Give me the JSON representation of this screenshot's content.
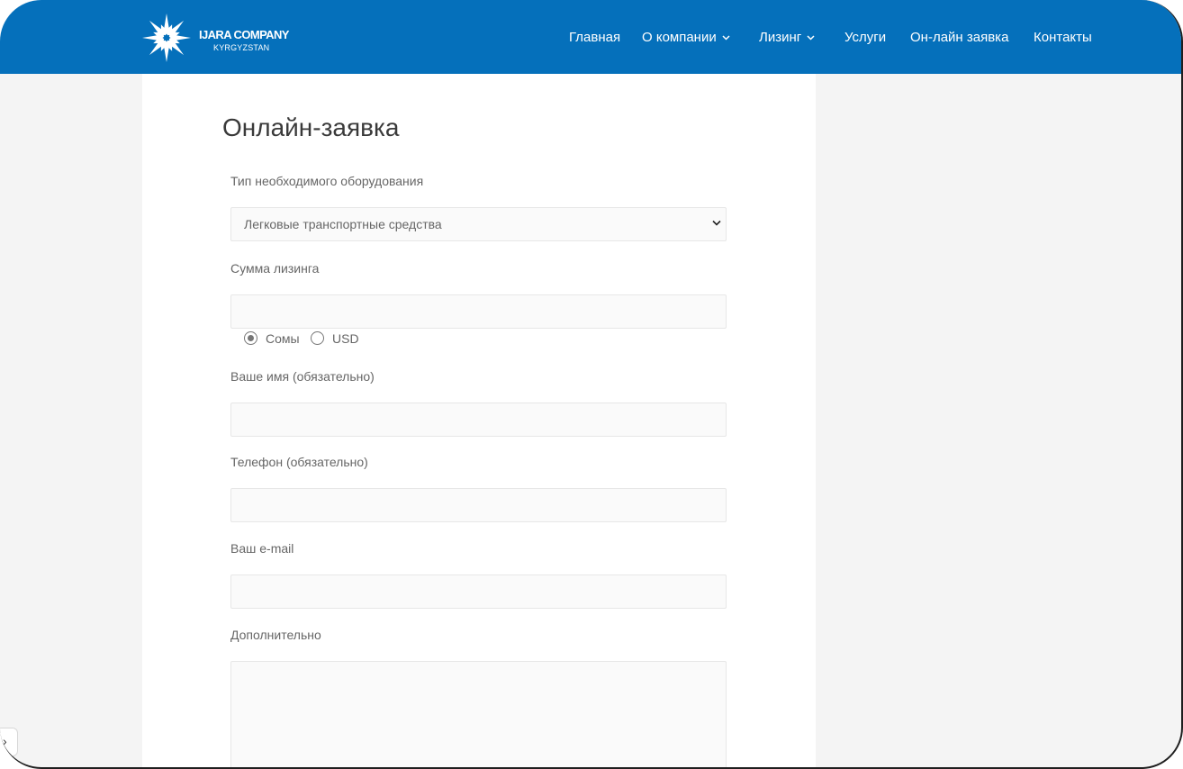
{
  "colors": {
    "header": "#0570bb",
    "page_bg": "#f4f4f4",
    "field_bg": "#fafafa"
  },
  "logo": {
    "name": "IJARA COMPANY",
    "subtitle": "KYRGYZSTAN",
    "icon": "flower-star-icon"
  },
  "nav": {
    "items": [
      {
        "label": "Главная",
        "dropdown": false
      },
      {
        "label": "О компании",
        "dropdown": true
      },
      {
        "label": "Лизинг",
        "dropdown": true
      },
      {
        "label": "Услуги",
        "dropdown": false
      },
      {
        "label": "Он-лайн заявка",
        "dropdown": false
      },
      {
        "label": "Контакты",
        "dropdown": false
      }
    ]
  },
  "form": {
    "title": "Онлайн-заявка",
    "equipment_label": "Тип необходимого оборудования",
    "equipment_value": "Легковые транспортные средства",
    "amount_label": "Сумма лизинга",
    "amount_value": "",
    "currency": {
      "options": [
        "Сомы",
        "USD"
      ],
      "selected": "Сомы"
    },
    "name_label": "Ваше имя (обязательно)",
    "phone_label": "Телефон (обязательно)",
    "email_label": "Ваш e-mail",
    "extra_label": "Дополнительно"
  },
  "side_toggle": {
    "label": "›"
  }
}
